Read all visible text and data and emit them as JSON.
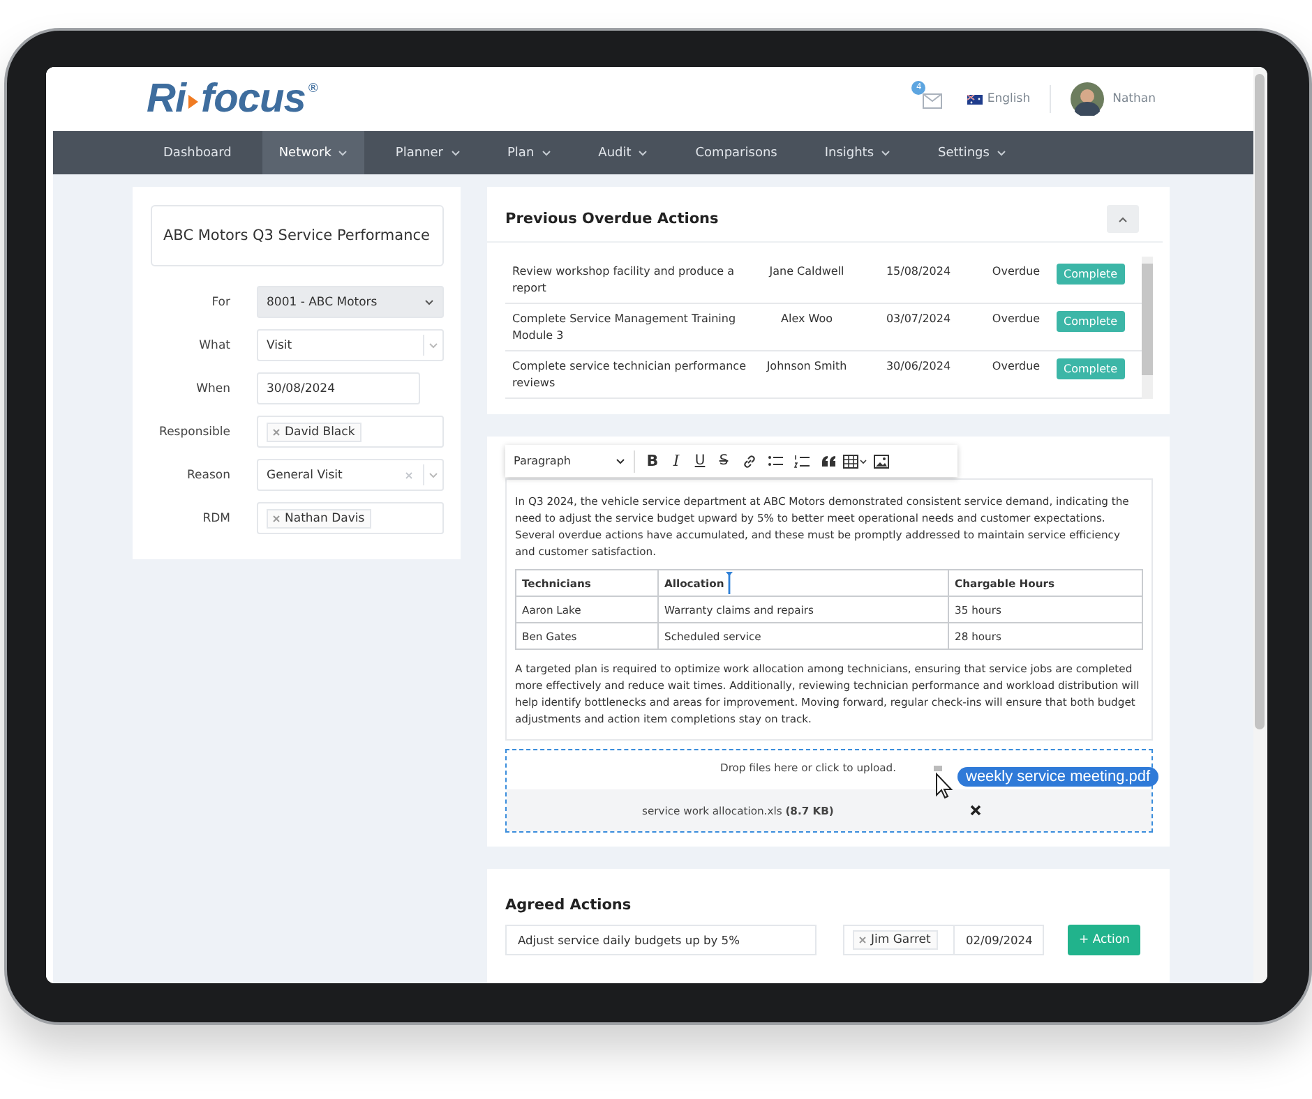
{
  "header": {
    "logo": {
      "left": "Ri",
      "right": "focus",
      "mark": "®"
    },
    "mail_badge": "4",
    "language": "English",
    "user": "Nathan"
  },
  "nav": [
    {
      "label": "Dashboard",
      "selected": false,
      "menu": false
    },
    {
      "label": "Network",
      "selected": true,
      "menu": true
    },
    {
      "label": "Planner",
      "selected": false,
      "menu": true
    },
    {
      "label": "Plan",
      "selected": false,
      "menu": true
    },
    {
      "label": "Audit",
      "selected": false,
      "menu": true
    },
    {
      "label": "Comparisons",
      "selected": false,
      "menu": false
    },
    {
      "label": "Insights",
      "selected": false,
      "menu": true
    },
    {
      "label": "Settings",
      "selected": false,
      "menu": true
    }
  ],
  "visit": {
    "title": "ABC Motors Q3 Service Performance",
    "fields": [
      {
        "label": "For",
        "kind": "select",
        "value": "8001 - ABC Motors"
      },
      {
        "label": "What",
        "kind": "combo",
        "value": "Visit",
        "clearable": false
      },
      {
        "label": "When",
        "kind": "date",
        "value": "30/08/2024"
      },
      {
        "label": "Responsible",
        "kind": "tags",
        "tags": [
          "David Black"
        ]
      },
      {
        "label": "Reason",
        "kind": "combo",
        "value": "General Visit",
        "clearable": true
      },
      {
        "label": "RDM",
        "kind": "tags",
        "tags": [
          "Nathan Davis"
        ]
      }
    ]
  },
  "overdue": {
    "title": "Previous Overdue Actions",
    "rows": [
      {
        "action": "Review workshop facility and produce a report",
        "person": "Jane Caldwell",
        "date": "15/08/2024",
        "status": "Overdue",
        "button": "Complete"
      },
      {
        "action": "Complete Service Management Training Module 3",
        "person": "Alex Woo",
        "date": "03/07/2024",
        "status": "Overdue",
        "button": "Complete"
      },
      {
        "action": "Complete service technician performance reviews",
        "person": "Johnson Smith",
        "date": "30/06/2024",
        "status": "Overdue",
        "button": "Complete"
      }
    ]
  },
  "editor": {
    "toolbar": [
      {
        "kind": "dropdown",
        "label": "Paragraph"
      },
      {
        "kind": "bold",
        "label": "B"
      },
      {
        "kind": "italic",
        "label": "I"
      },
      {
        "kind": "underline",
        "label": "U"
      },
      {
        "kind": "strike",
        "label": "S"
      },
      {
        "kind": "link"
      },
      {
        "kind": "bullets"
      },
      {
        "kind": "numbers"
      },
      {
        "kind": "quote"
      },
      {
        "kind": "table"
      },
      {
        "kind": "image"
      }
    ],
    "blocks": [
      {
        "kind": "paragraph",
        "text": "In Q3 2024, the vehicle service department at ABC Motors demonstrated consistent service demand, indicating the need to adjust the service budget upward by 5% to better meet operational needs and customer expectations. Several overdue actions have accumulated, and these must be promptly addressed to maintain service efficiency and customer satisfaction."
      },
      {
        "kind": "table",
        "columns": [
          "Technicians",
          "Allocation",
          "Chargable Hours"
        ],
        "rows": [
          [
            "Aaron Lake",
            "Warranty claims and repairs",
            "35 hours"
          ],
          [
            "Ben Gates",
            "Scheduled service",
            "28 hours"
          ]
        ]
      },
      {
        "kind": "paragraph",
        "text": "A targeted plan is required to optimize work allocation among technicians, ensuring that service jobs are completed more effectively and reduce wait times. Additionally, reviewing technician performance and workload distribution will help identify bottlenecks and areas for improvement. Moving forward, regular check-ins will ensure that both budget adjustments and action item completions stay on track."
      }
    ]
  },
  "upload": {
    "prompt": "Drop files here or click to upload.",
    "files": [
      {
        "name": "service work allocation.xls",
        "size": "(8.7 KB)"
      }
    ],
    "dragging": "weekly service meeting.pdf"
  },
  "agreed": {
    "title": "Agreed Actions",
    "rows": [
      {
        "action": "Adjust service daily budgets up by 5%",
        "assignees": [
          "Jim Garret"
        ],
        "date": "02/09/2024",
        "button": "+ Action"
      }
    ]
  }
}
